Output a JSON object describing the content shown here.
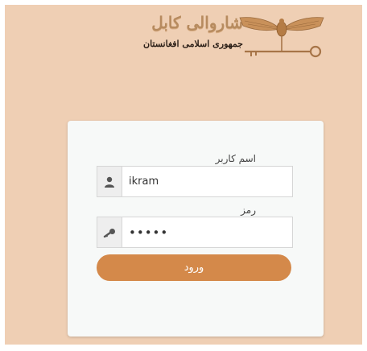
{
  "header": {
    "title": "شاروالی کابل",
    "subtitle": "جمهوری اسلامی افغانستان",
    "emblem_icon": "eagle-key-emblem"
  },
  "login": {
    "username_label": "اسم کاربر",
    "username_value": "ikram",
    "username_icon": "user-icon",
    "password_label": "رمز",
    "password_value": "•••••",
    "password_icon": "key-icon",
    "submit_label": "ورود"
  },
  "colors": {
    "background": "#efcfb4",
    "button": "#d4894a",
    "card": "#f7f9f8"
  }
}
